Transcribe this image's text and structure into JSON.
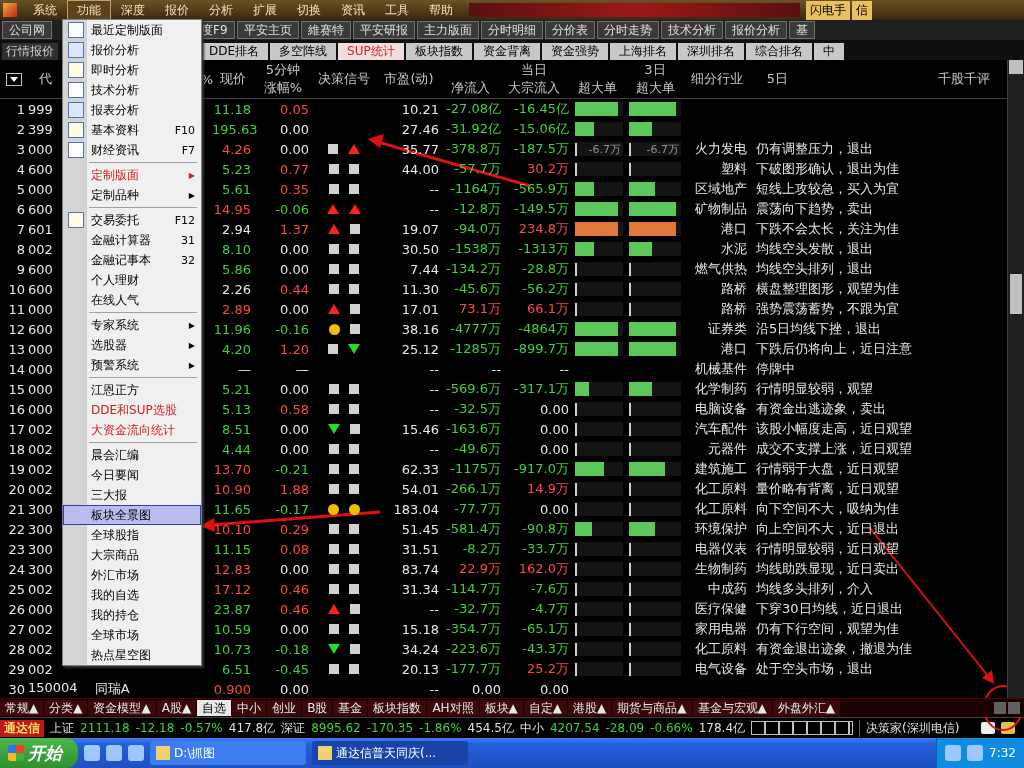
{
  "menubar": {
    "items": [
      {
        "label": "系统",
        "selected": false
      },
      {
        "label": "功能",
        "selected": true
      },
      {
        "label": "深度",
        "selected": false
      },
      {
        "label": "报价",
        "selected": false
      },
      {
        "label": "分析",
        "selected": false
      },
      {
        "label": "扩展",
        "selected": false
      },
      {
        "label": "切换",
        "selected": false
      },
      {
        "label": "资讯",
        "selected": false
      },
      {
        "label": "工具",
        "selected": false
      },
      {
        "label": "帮助",
        "selected": false
      }
    ],
    "right_buttons": [
      "闪电手",
      "信"
    ]
  },
  "toolbar": {
    "left": "公司网",
    "items": [
      "度F9",
      "平安主页",
      "維赛特",
      "平安研报",
      "主力版面",
      "分时明细",
      "分价表",
      "分时走势",
      "技术分析",
      "报价分析",
      "基"
    ]
  },
  "tabs": {
    "left": "行情报价",
    "items": [
      {
        "label": "DDE排名",
        "selected": false
      },
      {
        "label": "多空阵线",
        "selected": false
      },
      {
        "label": "SUP统计",
        "selected": true
      },
      {
        "label": "板块指数",
        "selected": false
      },
      {
        "label": "资金背离",
        "selected": false
      },
      {
        "label": "资金强势",
        "selected": false
      },
      {
        "label": "上海排名",
        "selected": false
      },
      {
        "label": "深圳排名",
        "selected": false
      },
      {
        "label": "综合排名",
        "selected": false
      },
      {
        "label": "中",
        "selected": false
      }
    ]
  },
  "table": {
    "columns": {
      "code": "代",
      "pct_fragment": "%",
      "price": "现价",
      "chg5_top": "5分钟",
      "chg5_bottom": "涨幅%",
      "signal": "决策信号",
      "pe": "市盈(动)",
      "today": "当日",
      "net": "净流入",
      "bulk": "大宗流入",
      "super": "超大单",
      "three_day": "3日",
      "super3": "超大单",
      "industry": "细分行业",
      "five_day": "5日",
      "comment": "千股千评"
    },
    "rows": [
      {
        "n": "1",
        "code": "999",
        "price": {
          "text": "11.18",
          "color": "#40d040"
        },
        "chg": {
          "text": "0.05",
          "color": "#ff4848"
        },
        "signals": [],
        "pe": "10.21",
        "net": {
          "text": "-27.08亿",
          "color": "#40d040"
        },
        "bulk": {
          "text": "-16.45亿",
          "color": "#40d040"
        },
        "super": [
          {
            "kind": "bar",
            "level": 0.9,
            "color": "#5cc85c"
          },
          {
            "kind": "bar",
            "level": 0.9,
            "color": "#5cc85c"
          }
        ]
      },
      {
        "n": "2",
        "code": "399",
        "price": {
          "text": "195.63",
          "color": "#40d040"
        },
        "chg": {
          "text": "0.00",
          "color": "#e8e8e8"
        },
        "signals": [],
        "pe": "27.46",
        "net": {
          "text": "-31.92亿",
          "color": "#40d040"
        },
        "bulk": {
          "text": "-15.06亿",
          "color": "#40d040"
        },
        "super": [
          {
            "kind": "bar",
            "level": 0.4,
            "color": "#5cc85c"
          },
          {
            "kind": "bar",
            "level": 0.45,
            "color": "#5cc85c"
          }
        ]
      },
      {
        "n": "3",
        "code": "000",
        "price": {
          "text": "4.26",
          "color": "#ff4848"
        },
        "chg": {
          "text": "0.00",
          "color": "#e8e8e8"
        },
        "signals": [
          {
            "kind": "square"
          },
          {
            "kind": "up"
          }
        ],
        "pe": "35.77",
        "net": {
          "text": "-378.8万",
          "color": "#40d040"
        },
        "bulk": {
          "text": "-187.5万",
          "color": "#40d040"
        },
        "super": [
          {
            "kind": "tick",
            "text": "-6.7万"
          },
          {
            "kind": "tick",
            "text": "-6.7万"
          }
        ],
        "industry": "火力发电",
        "comment": "仍有调整压力，退出"
      },
      {
        "n": "4",
        "code": "600",
        "price": {
          "text": "5.23",
          "color": "#40d040"
        },
        "chg": {
          "text": "0.77",
          "color": "#ff4848"
        },
        "signals": [
          {
            "kind": "square"
          },
          {
            "kind": "square"
          }
        ],
        "pe": "44.00",
        "net": {
          "text": "-57.7万",
          "color": "#40d040"
        },
        "bulk": {
          "text": "30.2万",
          "color": "#ff4848"
        },
        "super": [
          {
            "kind": "tick"
          },
          {
            "kind": "tick"
          }
        ],
        "industry": "塑料",
        "comment": "下破图形确认，退出为佳"
      },
      {
        "n": "5",
        "code": "000",
        "price": {
          "text": "5.61",
          "color": "#40d040"
        },
        "chg": {
          "text": "0.35",
          "color": "#ff4848"
        },
        "signals": [
          {
            "kind": "square"
          },
          {
            "kind": "square"
          }
        ],
        "pe": "--",
        "net": {
          "text": "-1164万",
          "color": "#40d040"
        },
        "bulk": {
          "text": "-565.9万",
          "color": "#40d040"
        },
        "super": [
          {
            "kind": "bar",
            "level": 0.4,
            "color": "#5cc85c"
          },
          {
            "kind": "bar",
            "level": 0.5,
            "color": "#5cc85c"
          }
        ],
        "industry": "区域地产",
        "comment": "短线上攻较急，买入为宜"
      },
      {
        "n": "6",
        "code": "600",
        "price": {
          "text": "14.95",
          "color": "#ff4848"
        },
        "chg": {
          "text": "-0.06",
          "color": "#40d040"
        },
        "signals": [
          {
            "kind": "up"
          },
          {
            "kind": "up"
          }
        ],
        "pe": "--",
        "net": {
          "text": "-12.8万",
          "color": "#40d040"
        },
        "bulk": {
          "text": "-149.5万",
          "color": "#40d040"
        },
        "super": [
          {
            "kind": "bar",
            "level": 0.9,
            "color": "#5cc85c"
          },
          {
            "kind": "bar",
            "level": 0.9,
            "color": "#5cc85c"
          }
        ],
        "industry": "矿物制品",
        "comment": "震荡向下趋势，卖出"
      },
      {
        "n": "7",
        "code": "601",
        "price": {
          "text": "2.94",
          "color": "#e8e8e8"
        },
        "chg": {
          "text": "1.37",
          "color": "#ff4848"
        },
        "signals": [
          {
            "kind": "up"
          },
          {
            "kind": "square"
          }
        ],
        "pe": "19.07",
        "net": {
          "text": "-94.0万",
          "color": "#40d040"
        },
        "bulk": {
          "text": "234.8万",
          "color": "#ff4848"
        },
        "super": [
          {
            "kind": "bar",
            "level": 0.9,
            "color": "#e0783a"
          },
          {
            "kind": "bar",
            "level": 0.9,
            "color": "#e0783a"
          }
        ],
        "industry": "港口",
        "comment": "下跌不会太长，关注为佳"
      },
      {
        "n": "8",
        "code": "002",
        "price": {
          "text": "8.10",
          "color": "#40d040"
        },
        "chg": {
          "text": "0.00",
          "color": "#e8e8e8"
        },
        "signals": [
          {
            "kind": "square"
          },
          {
            "kind": "square"
          }
        ],
        "pe": "30.50",
        "net": {
          "text": "-1538万",
          "color": "#40d040"
        },
        "bulk": {
          "text": "-1313万",
          "color": "#40d040"
        },
        "super": [
          {
            "kind": "bar",
            "level": 0.4,
            "color": "#5cc85c"
          },
          {
            "kind": "bar",
            "level": 0.45,
            "color": "#5cc85c"
          }
        ],
        "industry": "水泥",
        "comment": "均线空头发散，退出"
      },
      {
        "n": "9",
        "code": "600",
        "price": {
          "text": "5.86",
          "color": "#40d040"
        },
        "chg": {
          "text": "0.00",
          "color": "#e8e8e8"
        },
        "signals": [
          {
            "kind": "square"
          },
          {
            "kind": "square"
          }
        ],
        "pe": "7.44",
        "net": {
          "text": "-134.2万",
          "color": "#40d040"
        },
        "bulk": {
          "text": "-28.8万",
          "color": "#40d040"
        },
        "super": [
          {
            "kind": "tick"
          },
          {
            "kind": "tick"
          }
        ],
        "industry": "燃气供热",
        "comment": "均线空头排列，退出"
      },
      {
        "n": "10",
        "code": "600",
        "price": {
          "text": "2.26",
          "color": "#e8e8e8"
        },
        "chg": {
          "text": "0.44",
          "color": "#ff4848"
        },
        "signals": [
          {
            "kind": "square"
          },
          {
            "kind": "square"
          }
        ],
        "pe": "11.30",
        "net": {
          "text": "-45.6万",
          "color": "#40d040"
        },
        "bulk": {
          "text": "-56.2万",
          "color": "#40d040"
        },
        "super": [
          {
            "kind": "tick"
          },
          {
            "kind": "tick"
          }
        ],
        "industry": "路桥",
        "comment": "横盘整理图形，观望为佳"
      },
      {
        "n": "11",
        "code": "000",
        "price": {
          "text": "2.89",
          "color": "#ff4848"
        },
        "chg": {
          "text": "0.00",
          "color": "#e8e8e8"
        },
        "signals": [
          {
            "kind": "up"
          },
          {
            "kind": "square"
          }
        ],
        "pe": "17.01",
        "net": {
          "text": "73.1万",
          "color": "#ff4848"
        },
        "bulk": {
          "text": "66.1万",
          "color": "#ff4848"
        },
        "super": [
          {
            "kind": "tick"
          },
          {
            "kind": "tick"
          }
        ],
        "industry": "路桥",
        "comment": "强势震荡蓄势，不跟为宜"
      },
      {
        "n": "12",
        "code": "600",
        "price": {
          "text": "11.96",
          "color": "#40d040"
        },
        "chg": {
          "text": "-0.16",
          "color": "#40d040"
        },
        "signals": [
          {
            "kind": "dot"
          },
          {
            "kind": "square"
          }
        ],
        "pe": "38.16",
        "net": {
          "text": "-4777万",
          "color": "#40d040"
        },
        "bulk": {
          "text": "-4864万",
          "color": "#40d040"
        },
        "super": [
          {
            "kind": "bar",
            "level": 0.9,
            "color": "#5cc85c"
          },
          {
            "kind": "bar",
            "level": 0.9,
            "color": "#5cc85c"
          }
        ],
        "industry": "证券类",
        "comment": "沿5日均线下挫，退出"
      },
      {
        "n": "13",
        "code": "000",
        "price": {
          "text": "4.20",
          "color": "#40d040"
        },
        "chg": {
          "text": "1.20",
          "color": "#ff4848"
        },
        "signals": [
          {
            "kind": "square"
          },
          {
            "kind": "down"
          }
        ],
        "pe": "25.12",
        "net": {
          "text": "-1285万",
          "color": "#40d040"
        },
        "bulk": {
          "text": "-899.7万",
          "color": "#40d040"
        },
        "super": [
          {
            "kind": "bar",
            "level": 0.9,
            "color": "#5cc85c"
          },
          {
            "kind": "bar",
            "level": 0.9,
            "color": "#5cc85c"
          }
        ],
        "industry": "港口",
        "comment": "下跌后仍将向上，近日注意"
      },
      {
        "n": "14",
        "code": "000",
        "price": {
          "text": "—"
        },
        "chg": {
          "text": "—"
        },
        "signals": [],
        "pe": "--",
        "net": {
          "text": "--"
        },
        "bulk": {
          "text": "--"
        },
        "super": [],
        "industry": "机械基件",
        "comment": "停牌中"
      },
      {
        "n": "15",
        "code": "000",
        "price": {
          "text": "5.21",
          "color": "#40d040"
        },
        "chg": {
          "text": "0.00",
          "color": "#e8e8e8"
        },
        "signals": [
          {
            "kind": "square"
          },
          {
            "kind": "square"
          }
        ],
        "pe": "--",
        "net": {
          "text": "-569.6万",
          "color": "#40d040"
        },
        "bulk": {
          "text": "-317.1万",
          "color": "#40d040"
        },
        "super": [
          {
            "kind": "bar",
            "level": 0.3,
            "color": "#5cc85c"
          },
          {
            "kind": "bar",
            "level": 0.45,
            "color": "#5cc85c"
          }
        ],
        "industry": "化学制药",
        "comment": "行情明显较弱，观望"
      },
      {
        "n": "16",
        "code": "000",
        "price": {
          "text": "5.13",
          "color": "#40d040"
        },
        "chg": {
          "text": "0.58",
          "color": "#ff4848"
        },
        "signals": [
          {
            "kind": "square"
          },
          {
            "kind": "square"
          }
        ],
        "pe": "--",
        "net": {
          "text": "-32.5万",
          "color": "#40d040"
        },
        "bulk": {
          "text": "0.00",
          "color": "#e8e8e8"
        },
        "super": [
          {
            "kind": "tick"
          },
          {
            "kind": "tick"
          }
        ],
        "industry": "电脑设备",
        "comment": "有资金出逃迹象，卖出"
      },
      {
        "n": "17",
        "code": "002",
        "price": {
          "text": "8.51",
          "color": "#40d040"
        },
        "chg": {
          "text": "0.00",
          "color": "#e8e8e8"
        },
        "signals": [
          {
            "kind": "down"
          },
          {
            "kind": "square"
          }
        ],
        "pe": "15.46",
        "net": {
          "text": "-163.6万",
          "color": "#40d040"
        },
        "bulk": {
          "text": "0.00",
          "color": "#e8e8e8"
        },
        "super": [
          {
            "kind": "tick"
          },
          {
            "kind": "tick"
          }
        ],
        "industry": "汽车配件",
        "comment": "该股小幅度走高，近日观望"
      },
      {
        "n": "18",
        "code": "002",
        "price": {
          "text": "4.44",
          "color": "#40d040"
        },
        "chg": {
          "text": "0.00",
          "color": "#e8e8e8"
        },
        "signals": [
          {
            "kind": "square"
          },
          {
            "kind": "square"
          }
        ],
        "pe": "--",
        "net": {
          "text": "-49.6万",
          "color": "#40d040"
        },
        "bulk": {
          "text": "0.00",
          "color": "#e8e8e8"
        },
        "super": [
          {
            "kind": "tick"
          },
          {
            "kind": "tick"
          }
        ],
        "industry": "元器件",
        "comment": "成交不支撑上涨，近日观望"
      },
      {
        "n": "19",
        "code": "002",
        "price": {
          "text": "13.70",
          "color": "#ff4848"
        },
        "chg": {
          "text": "-0.21",
          "color": "#40d040"
        },
        "signals": [
          {
            "kind": "square"
          },
          {
            "kind": "square"
          }
        ],
        "pe": "62.33",
        "net": {
          "text": "-1175万",
          "color": "#40d040"
        },
        "bulk": {
          "text": "-917.0万",
          "color": "#40d040"
        },
        "super": [
          {
            "kind": "bar",
            "level": 0.6,
            "color": "#5cc85c"
          },
          {
            "kind": "bar",
            "level": 0.7,
            "color": "#5cc85c"
          }
        ],
        "industry": "建筑施工",
        "comment": "行情弱于大盘，近日观望"
      },
      {
        "n": "20",
        "code": "002",
        "price": {
          "text": "10.90",
          "color": "#ff4848"
        },
        "chg": {
          "text": "1.88",
          "color": "#ff4848"
        },
        "signals": [
          {
            "kind": "square"
          },
          {
            "kind": "square"
          }
        ],
        "pe": "54.01",
        "net": {
          "text": "-266.1万",
          "color": "#40d040"
        },
        "bulk": {
          "text": "14.9万",
          "color": "#ff4848"
        },
        "super": [
          {
            "kind": "tick"
          },
          {
            "kind": "tick"
          }
        ],
        "industry": "化工原料",
        "comment": "量价略有背离，近日观望"
      },
      {
        "n": "21",
        "code": "300",
        "price": {
          "text": "11.65",
          "color": "#40d040"
        },
        "chg": {
          "text": "-0.17",
          "color": "#40d040"
        },
        "signals": [
          {
            "kind": "dot"
          },
          {
            "kind": "dot"
          }
        ],
        "pe": "183.04",
        "net": {
          "text": "-77.7万",
          "color": "#40d040"
        },
        "bulk": {
          "text": "0.00",
          "color": "#e8e8e8"
        },
        "super": [
          {
            "kind": "tick"
          },
          {
            "kind": "tick"
          }
        ],
        "industry": "化工原料",
        "comment": "向下空间不大，吸纳为佳"
      },
      {
        "n": "22",
        "code": "300",
        "price": {
          "text": "10.10",
          "color": "#ff4848"
        },
        "chg": {
          "text": "0.29",
          "color": "#ff4848"
        },
        "signals": [
          {
            "kind": "square"
          },
          {
            "kind": "square"
          }
        ],
        "pe": "51.45",
        "net": {
          "text": "-581.4万",
          "color": "#40d040"
        },
        "bulk": {
          "text": "-90.8万",
          "color": "#40d040"
        },
        "super": [
          {
            "kind": "bar",
            "level": 0.35,
            "color": "#5cc85c"
          },
          {
            "kind": "bar",
            "level": 0.5,
            "color": "#5cc85c"
          }
        ],
        "industry": "环境保护",
        "comment": "向上空间不大，近日退出"
      },
      {
        "n": "23",
        "code": "300",
        "price": {
          "text": "11.15",
          "color": "#40d040"
        },
        "chg": {
          "text": "0.08",
          "color": "#ff4848"
        },
        "signals": [
          {
            "kind": "square"
          },
          {
            "kind": "square"
          }
        ],
        "pe": "31.51",
        "net": {
          "text": "-8.2万",
          "color": "#40d040"
        },
        "bulk": {
          "text": "-33.7万",
          "color": "#40d040"
        },
        "super": [
          {
            "kind": "tick"
          },
          {
            "kind": "tick"
          }
        ],
        "industry": "电器仪表",
        "comment": "行情明显较弱，近日观望"
      },
      {
        "n": "24",
        "code": "300",
        "price": {
          "text": "12.83",
          "color": "#ff4848"
        },
        "chg": {
          "text": "0.00",
          "color": "#e8e8e8"
        },
        "signals": [
          {
            "kind": "square"
          },
          {
            "kind": "square"
          }
        ],
        "pe": "83.74",
        "net": {
          "text": "22.9万",
          "color": "#ff4848"
        },
        "bulk": {
          "text": "162.0万",
          "color": "#ff4848"
        },
        "super": [
          {
            "kind": "tick"
          },
          {
            "kind": "tick"
          }
        ],
        "industry": "生物制药",
        "comment": "均线助跌显现，近日卖出"
      },
      {
        "n": "25",
        "code": "002",
        "price": {
          "text": "17.12",
          "color": "#ff4848"
        },
        "chg": {
          "text": "0.46",
          "color": "#ff4848"
        },
        "signals": [
          {
            "kind": "square"
          },
          {
            "kind": "square"
          }
        ],
        "pe": "31.34",
        "net": {
          "text": "-114.7万",
          "color": "#40d040"
        },
        "bulk": {
          "text": "-7.6万",
          "color": "#40d040"
        },
        "super": [
          {
            "kind": "tick"
          },
          {
            "kind": "tick"
          }
        ],
        "industry": "中成药",
        "comment": "均线多头排列，介入"
      },
      {
        "n": "26",
        "code": "000",
        "price": {
          "text": "23.87",
          "color": "#40d040"
        },
        "chg": {
          "text": "0.46",
          "color": "#ff4848"
        },
        "signals": [
          {
            "kind": "up"
          },
          {
            "kind": "square"
          }
        ],
        "pe": "--",
        "net": {
          "text": "-32.7万",
          "color": "#40d040"
        },
        "bulk": {
          "text": "-4.7万",
          "color": "#40d040"
        },
        "super": [
          {
            "kind": "tick"
          },
          {
            "kind": "tick"
          }
        ],
        "industry": "医疗保健",
        "comment": "下穿30日均线，近日退出"
      },
      {
        "n": "27",
        "code": "002",
        "price": {
          "text": "10.59",
          "color": "#40d040"
        },
        "chg": {
          "text": "0.00",
          "color": "#e8e8e8"
        },
        "signals": [
          {
            "kind": "square"
          },
          {
            "kind": "square"
          }
        ],
        "pe": "15.18",
        "net": {
          "text": "-354.7万",
          "color": "#40d040"
        },
        "bulk": {
          "text": "-65.1万",
          "color": "#40d040"
        },
        "super": [
          {
            "kind": "tick"
          },
          {
            "kind": "tick"
          }
        ],
        "industry": "家用电器",
        "comment": "仍有下行空间，观望为佳"
      },
      {
        "n": "28",
        "code": "002",
        "price": {
          "text": "10.73",
          "color": "#40d040"
        },
        "chg": {
          "text": "-0.18",
          "color": "#40d040"
        },
        "signals": [
          {
            "kind": "down"
          },
          {
            "kind": "square"
          }
        ],
        "pe": "34.24",
        "net": {
          "text": "-223.6万",
          "color": "#40d040"
        },
        "bulk": {
          "text": "-43.3万",
          "color": "#40d040"
        },
        "super": [
          {
            "kind": "tick"
          },
          {
            "kind": "tick"
          }
        ],
        "industry": "化工原料",
        "comment": "有资金退出迹象，撤退为佳"
      },
      {
        "n": "29",
        "code": "002",
        "price": {
          "text": "6.51",
          "color": "#40d040"
        },
        "chg": {
          "text": "-0.45",
          "color": "#40d040"
        },
        "signals": [
          {
            "kind": "square"
          },
          {
            "kind": "square"
          }
        ],
        "pe": "20.13",
        "net": {
          "text": "-177.7万",
          "color": "#40d040"
        },
        "bulk": {
          "text": "25.2万",
          "color": "#ff4848"
        },
        "super": [
          {
            "kind": "tick"
          },
          {
            "kind": "tick"
          }
        ],
        "industry": "电气设备",
        "comment": "处于空头市场，退出"
      },
      {
        "n": "30",
        "code": "150004",
        "name": "同瑞A",
        "price": {
          "text": "0.900",
          "color": "#ff4848"
        },
        "chg": {
          "text": "0.00",
          "color": "#e8e8e8"
        },
        "signals": [],
        "pe": "--",
        "net": {
          "text": "0.00",
          "color": "#e8e8e8"
        },
        "bulk": {
          "text": "0.00",
          "color": "#e8e8e8"
        },
        "super": []
      }
    ]
  },
  "menu": {
    "items": [
      {
        "kind": "item",
        "label": "最近定制版面",
        "icon": true,
        "selected": false
      },
      {
        "kind": "item",
        "label": "报价分析",
        "icon": true,
        "selected": false
      },
      {
        "kind": "item",
        "label": "即时分析",
        "icon": true,
        "selected": false
      },
      {
        "kind": "item",
        "label": "技术分析",
        "icon": true,
        "selected": false
      },
      {
        "kind": "item",
        "label": "报表分析",
        "icon": true,
        "selected": false
      },
      {
        "kind": "item",
        "label": "基本资料",
        "shortcut": "F10",
        "icon": true,
        "selected": false
      },
      {
        "kind": "item",
        "label": "财经资讯",
        "shortcut": "F7",
        "icon": true,
        "selected": false
      },
      {
        "kind": "separator"
      },
      {
        "kind": "item",
        "label": "定制版面",
        "arrow": "▶",
        "accent": true,
        "selected": false
      },
      {
        "kind": "item",
        "label": "定制品种",
        "arrow": "▶",
        "selected": false
      },
      {
        "kind": "separator"
      },
      {
        "kind": "item",
        "label": "交易委托",
        "shortcut": "F12",
        "icon": true,
        "selected": false
      },
      {
        "kind": "item",
        "label": "金融计算器",
        "shortcut": "31",
        "selected": false
      },
      {
        "kind": "item",
        "label": "金融记事本",
        "shortcut": "32",
        "selected": false
      },
      {
        "kind": "item",
        "label": "个人理财",
        "selected": false
      },
      {
        "kind": "item",
        "label": "在线人气",
        "selected": false
      },
      {
        "kind": "separator"
      },
      {
        "kind": "item",
        "label": "专家系统",
        "arrow": "▶",
        "selected": false
      },
      {
        "kind": "item",
        "label": "选股器",
        "arrow": "▶",
        "selected": false
      },
      {
        "kind": "item",
        "label": "预警系统",
        "arrow": "▶",
        "selected": false
      },
      {
        "kind": "separator"
      },
      {
        "kind": "item",
        "label": "江恩正方",
        "selected": false
      },
      {
        "kind": "item",
        "label": "DDE和SUP选股",
        "accent": true,
        "selected": false
      },
      {
        "kind": "item",
        "label": "大资金流向统计",
        "accent": true,
        "selected": false
      },
      {
        "kind": "separator"
      },
      {
        "kind": "item",
        "label": "晨会汇编",
        "selected": false
      },
      {
        "kind": "item",
        "label": "今日要闻",
        "selected": false
      },
      {
        "kind": "item",
        "label": "三大报",
        "selected": false
      },
      {
        "kind": "item",
        "label": "板块全景图",
        "selected": true
      },
      {
        "kind": "item",
        "label": "全球股指",
        "selected": false
      },
      {
        "kind": "item",
        "label": "大宗商品",
        "selected": false
      },
      {
        "kind": "item",
        "label": "外汇市场",
        "selected": false
      },
      {
        "kind": "item",
        "label": "我的自选",
        "selected": false
      },
      {
        "kind": "item",
        "label": "我的持仓",
        "selected": false
      },
      {
        "kind": "item",
        "label": "全球市场",
        "selected": false
      },
      {
        "kind": "item",
        "label": "热点星空图",
        "selected": false
      }
    ]
  },
  "bottom_tabs": [
    {
      "label": "常规▲",
      "selected": false
    },
    {
      "label": "分类▲",
      "selected": false
    },
    {
      "label": "资金模型▲",
      "selected": false
    },
    {
      "label": "A股▲",
      "selected": false
    },
    {
      "label": "自选",
      "selected": true
    },
    {
      "label": "中小",
      "selected": false
    },
    {
      "label": "创业",
      "selected": false
    },
    {
      "label": "B股",
      "selected": false
    },
    {
      "label": "基金",
      "selected": false
    },
    {
      "label": "板块指数",
      "selected": false
    },
    {
      "label": "AH对照",
      "selected": false
    },
    {
      "label": "板块▲",
      "selected": false
    },
    {
      "label": "自定▲",
      "selected": false
    },
    {
      "label": "港股▲",
      "selected": false
    },
    {
      "label": "期货与商品▲",
      "selected": false
    },
    {
      "label": "基金与宏观▲",
      "selected": false
    },
    {
      "label": "外盘外汇▲",
      "selected": false
    }
  ],
  "status_bar": {
    "brand": "通达信",
    "indices": [
      {
        "name": "上证",
        "value": "2111.18",
        "change": "-12.18",
        "pct": "-0.57%",
        "amount": "417.8亿"
      },
      {
        "name": "深证",
        "value": "8995.62",
        "change": "-170.35",
        "pct": "-1.86%",
        "amount": "454.5亿"
      },
      {
        "name": "中小",
        "value": "4207.54",
        "change": "-28.09",
        "pct": "-0.66%",
        "amount": "178.4亿"
      }
    ],
    "server": "决策家(深圳电信)"
  },
  "taskbar": {
    "start": "开始",
    "windows": [
      {
        "label": "D:\\抓图",
        "selected": false
      },
      {
        "label": "通达信普天同庆(...",
        "selected": true
      }
    ],
    "clock": "7:32"
  }
}
